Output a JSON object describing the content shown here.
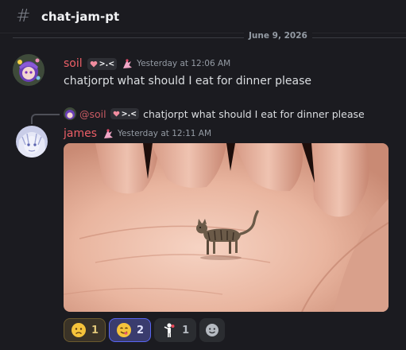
{
  "header": {
    "channel_name": "chat-jam-pt"
  },
  "divider": {
    "date": "June 9, 2026"
  },
  "messages": [
    {
      "author": "soil",
      "author_color": "#ed5f67",
      "tag": ">.<",
      "timestamp": "Yesterday at 12:06 AM",
      "text": "chatjorpt what should I eat for dinner please"
    },
    {
      "author": "james",
      "author_color": "#ed5f67",
      "timestamp": "Yesterday at 12:11 AM",
      "reply": {
        "author": "@soil",
        "tag": ">.<",
        "text": "chatjorpt what should I eat for dinner please"
      },
      "attachment": {
        "icon": "image-tiny-cat-on-palm"
      },
      "reactions": [
        {
          "icon": "worried-face-emoji",
          "count": "1"
        },
        {
          "icon": "yum-face-emoji",
          "count": "2"
        },
        {
          "icon": "person-gesture-emoji",
          "count": "1"
        },
        {
          "icon": "add-reaction-icon"
        }
      ]
    }
  ]
}
